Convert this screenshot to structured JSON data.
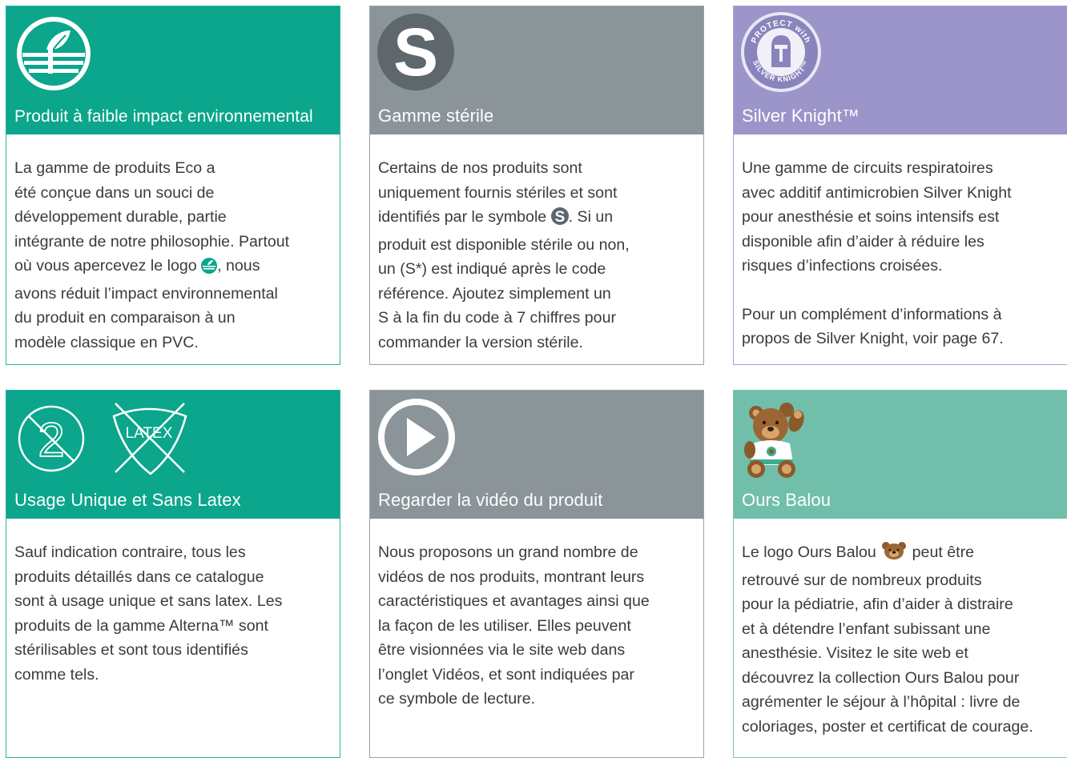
{
  "colors": {
    "teal": "#0ba68c",
    "gray": "#8a9499",
    "purple": "#9b95c9",
    "mint": "#71bfaa",
    "teal_border": "#2db49c",
    "gray_border": "#9aa2a6",
    "purple_border": "#a8a3d0",
    "mint_border": "#7fc4b1"
  },
  "cards": {
    "eco": {
      "icon": "eco-leaf-icon",
      "title": "Produit à faible impact environnemental",
      "lines": [
        "La gamme de produits Eco a",
        "été conçue dans un souci de",
        "développement durable, partie",
        "intégrante de notre philosophie. Partout",
        "où vous apercevez le logo",
        ", nous",
        "avons réduit l’impact environnemental",
        "du produit en comparaison à un",
        "modèle classique en PVC."
      ]
    },
    "sterile": {
      "icon": "sterile-s-icon",
      "icon_letter": "S",
      "title": "Gamme stérile",
      "lines": [
        "Certains de nos produits sont",
        "uniquement fournis stériles et sont",
        "identifiés par le symbole",
        ". Si un",
        "produit est disponible stérile ou non,",
        "un (S*) est indiqué après le code",
        "référence. Ajoutez simplement un",
        "S à la fin du code à 7 chiffres pour",
        "commander la version stérile."
      ],
      "inline_icon_letter": "S"
    },
    "silver": {
      "icon": "silver-knight-icon",
      "badge_top": "PROTECT with",
      "badge_bottom": "SILVER KNIGHT™",
      "title": "Silver Knight™",
      "p1": [
        "Une gamme de circuits respiratoires",
        "avec additif antimicrobien Silver Knight",
        "pour anesthésie et soins intensifs est",
        "disponible afin d’aider à réduire les",
        "risques d’infections croisées."
      ],
      "p2": [
        "Pour un complément d’informations à",
        "propos de Silver Knight, voir page 67."
      ]
    },
    "single": {
      "icon": "single-use-icon",
      "icon_number": "2",
      "latex_label": "LATEX",
      "title": "Usage Unique et Sans Latex",
      "lines": [
        "Sauf indication contraire, tous les",
        "produits détaillés dans ce catalogue",
        "sont à usage unique et sans latex. Les",
        "produits de la gamme Alterna™ sont",
        "stérilisables et sont tous identifiés",
        "comme tels."
      ]
    },
    "video": {
      "icon": "play-icon",
      "title": "Regarder la vidéo du produit",
      "lines": [
        "Nous proposons un grand nombre de",
        "vidéos de nos produits, montrant leurs",
        "caractéristiques et avantages ainsi que",
        "la façon de les utiliser. Elles peuvent",
        "être visionnées via le site web dans",
        "l’onglet Vidéos, et sont indiquées par",
        "ce symbole de lecture."
      ]
    },
    "balou": {
      "icon": "teddy-bear-icon",
      "title": "Ours Balou",
      "lines": [
        "Le logo Ours Balou",
        "peut être",
        "retrouvé sur de nombreux produits",
        "pour la pédiatrie, afin d’aider à distraire",
        "et à détendre l’enfant subissant une",
        "anesthésie. Visitez le site web et",
        "découvrez la collection Ours Balou pour",
        "agrémenter le séjour à l’hôpital : livre de",
        "coloriages, poster et certificat de courage."
      ]
    }
  }
}
